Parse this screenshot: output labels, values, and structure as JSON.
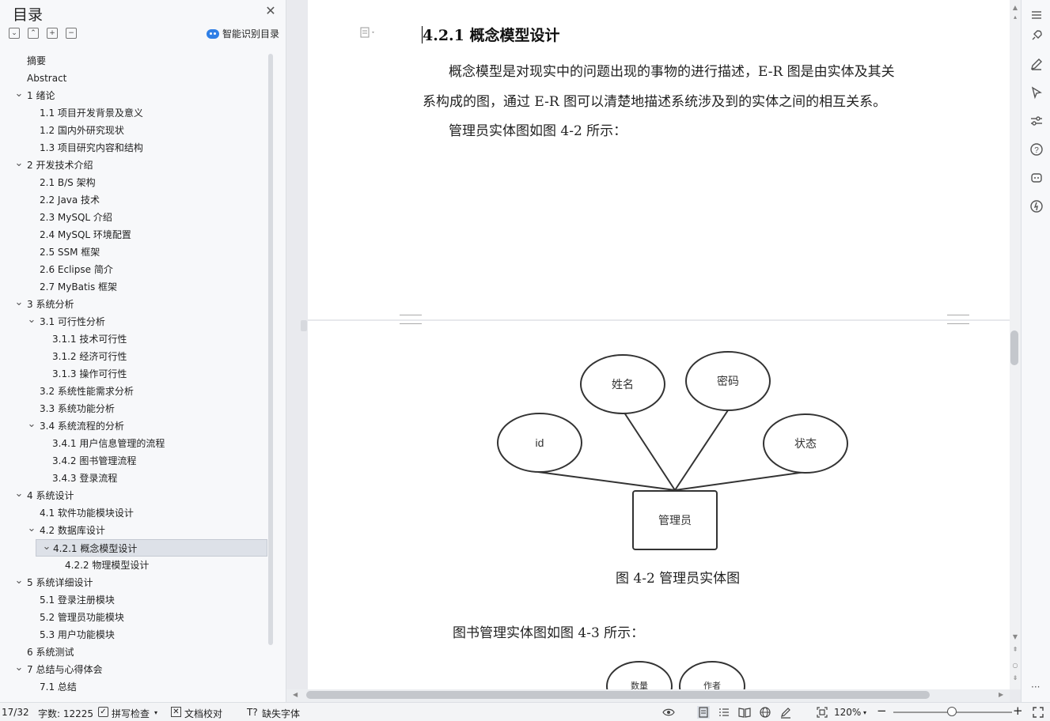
{
  "nav": {
    "title": "目录",
    "ai_button": "智能识别目录",
    "toc": [
      {
        "label": "摘要",
        "level": 1,
        "arrow": false
      },
      {
        "label": "Abstract",
        "level": 1,
        "arrow": false
      },
      {
        "label": "1 绪论",
        "level": 1,
        "arrow": true
      },
      {
        "label": "1.1 项目开发背景及意义",
        "level": 2,
        "arrow": false
      },
      {
        "label": "1.2 国内外研究现状",
        "level": 2,
        "arrow": false
      },
      {
        "label": "1.3 项目研究内容和结构",
        "level": 2,
        "arrow": false
      },
      {
        "label": "2 开发技术介绍",
        "level": 1,
        "arrow": true
      },
      {
        "label": "2.1 B/S 架构",
        "level": 2,
        "arrow": false
      },
      {
        "label": "2.2 Java 技术",
        "level": 2,
        "arrow": false
      },
      {
        "label": "2.3 MySQL  介绍",
        "level": 2,
        "arrow": false
      },
      {
        "label": "2.4 MySQL 环境配置",
        "level": 2,
        "arrow": false
      },
      {
        "label": "2.5 SSM 框架",
        "level": 2,
        "arrow": false
      },
      {
        "label": "2.6 Eclipse 简介",
        "level": 2,
        "arrow": false
      },
      {
        "label": "2.7 MyBatis 框架",
        "level": 2,
        "arrow": false
      },
      {
        "label": "3 系统分析",
        "level": 1,
        "arrow": true
      },
      {
        "label": "3.1 可行性分析",
        "level": 2,
        "arrow": true
      },
      {
        "label": "3.1.1 技术可行性",
        "level": 3,
        "arrow": false
      },
      {
        "label": "3.1.2 经济可行性",
        "level": 3,
        "arrow": false
      },
      {
        "label": "3.1.3 操作可行性",
        "level": 3,
        "arrow": false
      },
      {
        "label": "3.2 系统性能需求分析",
        "level": 2,
        "arrow": false
      },
      {
        "label": "3.3 系统功能分析",
        "level": 2,
        "arrow": false
      },
      {
        "label": "3.4 系统流程的分析",
        "level": 2,
        "arrow": true
      },
      {
        "label": "3.4.1  用户信息管理的流程",
        "level": 3,
        "arrow": false
      },
      {
        "label": "3.4.2 图书管理流程",
        "level": 3,
        "arrow": false
      },
      {
        "label": "3.4.3  登录流程",
        "level": 3,
        "arrow": false
      },
      {
        "label": "4 系统设计",
        "level": 1,
        "arrow": true
      },
      {
        "label": "4.1  软件功能模块设计",
        "level": 2,
        "arrow": false
      },
      {
        "label": "4.2 数据库设计",
        "level": 2,
        "arrow": true
      },
      {
        "label": "4.2.1 概念模型设计",
        "level": 3,
        "arrow": true,
        "selected": true
      },
      {
        "label": "4.2.2 物理模型设计",
        "level": 4,
        "arrow": false
      },
      {
        "label": "5 系统详细设计",
        "level": 1,
        "arrow": true
      },
      {
        "label": "5.1 登录注册模块",
        "level": 2,
        "arrow": false
      },
      {
        "label": "5.2 管理员功能模块",
        "level": 2,
        "arrow": false
      },
      {
        "label": "5.3 用户功能模块",
        "level": 2,
        "arrow": false
      },
      {
        "label": "6 系统测试",
        "level": 1,
        "arrow": false
      },
      {
        "label": "7 总结与心得体会",
        "level": 1,
        "arrow": true
      },
      {
        "label": "7.1  总结",
        "level": 2,
        "arrow": false
      }
    ]
  },
  "doc": {
    "heading": "4.2.1 概念模型设计",
    "para1_line1": "概念模型是对现实中的问题出现的事物的进行描述，E-R 图是由实体及其关",
    "para1_line2": "系构成的图，通过 E-R 图可以清楚地描述系统涉及到的实体之间的相互关系。",
    "para2": "管理员实体图如图 4-2 所示：",
    "diagram": {
      "entity": "管理员",
      "attributes": [
        "姓名",
        "密码",
        "id",
        "状态"
      ]
    },
    "caption": "图 4-2 管理员实体图",
    "para3": "图书管理实体图如图 4-3 所示：",
    "diagram2_attributes": [
      "数量",
      "作者"
    ]
  },
  "status": {
    "page": "17/32",
    "word_count": "字数: 12225",
    "spell_check": "拼写检查",
    "doc_proof": "文档校对",
    "missing_font": "缺失字体",
    "zoom": "120%"
  },
  "colors": {
    "accent": "#2f7fe6",
    "selected_bg": "#dde1e8"
  }
}
